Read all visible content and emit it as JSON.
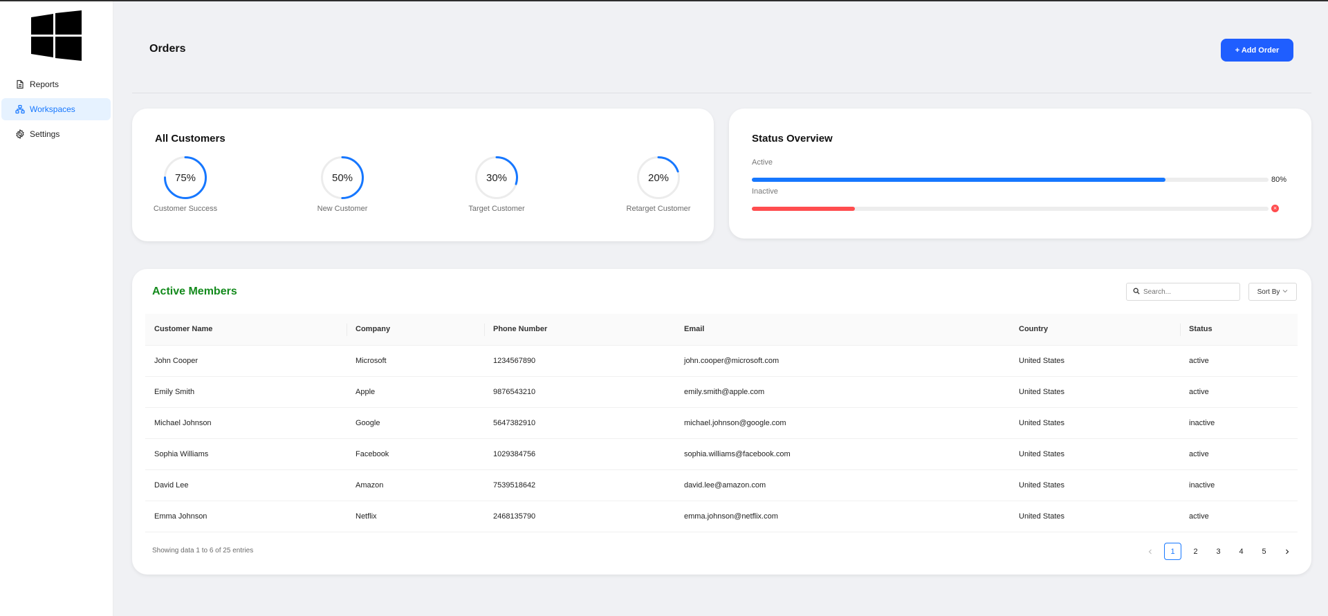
{
  "sidebar": {
    "items": [
      {
        "label": "Reports",
        "icon": "document-icon"
      },
      {
        "label": "Workspaces",
        "icon": "workspace-tree-icon"
      },
      {
        "label": "Settings",
        "icon": "gear-icon"
      }
    ],
    "active": "Workspaces"
  },
  "header": {
    "title": "Orders",
    "add_button": "+ Add Order"
  },
  "customers": {
    "title": "All Customers",
    "gauges": [
      {
        "value": 75,
        "display": "75%",
        "label": "Customer Success"
      },
      {
        "value": 50,
        "display": "50%",
        "label": "New Customer"
      },
      {
        "value": 30,
        "display": "30%",
        "label": "Target Customer"
      },
      {
        "value": 20,
        "display": "20%",
        "label": "Retarget Customer"
      }
    ]
  },
  "status": {
    "title": "Status Overview",
    "bars": [
      {
        "label": "Active",
        "value": 80,
        "display": "80%",
        "color": "#1677ff"
      },
      {
        "label": "Inactive",
        "value": 20,
        "display": "",
        "color": "#ff4d4f"
      }
    ]
  },
  "members": {
    "title": "Active Members",
    "search_placeholder": "Search...",
    "sort_label": "Sort By",
    "columns": [
      "Customer Name",
      "Company",
      "Phone Number",
      "Email",
      "Country",
      "Status"
    ],
    "rows": [
      [
        "John Cooper",
        "Microsoft",
        "1234567890",
        "john.cooper@microsoft.com",
        "United States",
        "active"
      ],
      [
        "Emily Smith",
        "Apple",
        "9876543210",
        "emily.smith@apple.com",
        "United States",
        "active"
      ],
      [
        "Michael Johnson",
        "Google",
        "5647382910",
        "michael.johnson@google.com",
        "United States",
        "inactive"
      ],
      [
        "Sophia Williams",
        "Facebook",
        "1029384756",
        "sophia.williams@facebook.com",
        "United States",
        "active"
      ],
      [
        "David Lee",
        "Amazon",
        "7539518642",
        "david.lee@amazon.com",
        "United States",
        "inactive"
      ],
      [
        "Emma Johnson",
        "Netflix",
        "2468135790",
        "emma.johnson@netflix.com",
        "United States",
        "active"
      ]
    ],
    "footer": "Showing data 1 to 6 of 25 entries",
    "pages": [
      "1",
      "2",
      "3",
      "4",
      "5"
    ],
    "current_page": "1"
  },
  "colors": {
    "accent": "#1677ff",
    "button": "#1f5eff",
    "title_green": "#138a1c",
    "danger": "#ff4d4f"
  }
}
